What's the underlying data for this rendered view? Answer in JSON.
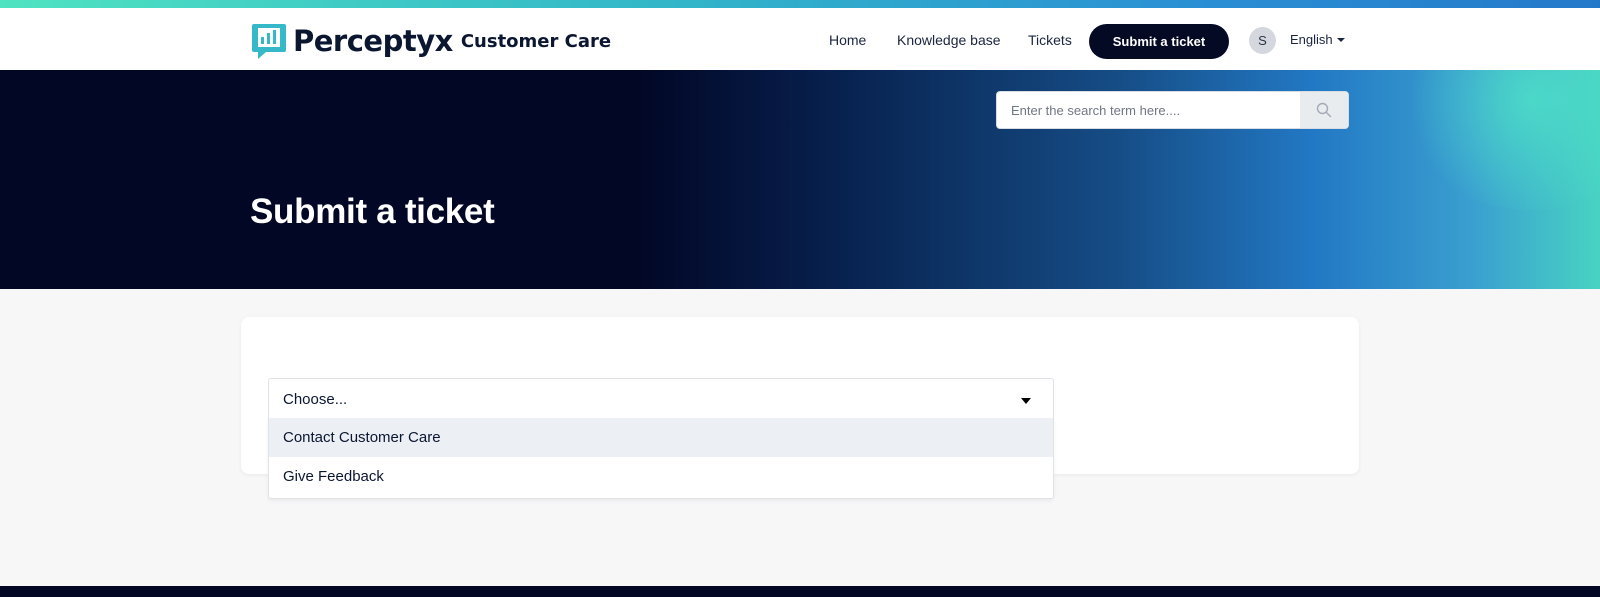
{
  "header": {
    "brand": "Perceptyx",
    "brand_sub": "Customer Care",
    "nav": {
      "home": "Home",
      "knowledge_base": "Knowledge base",
      "tickets": "Tickets",
      "submit": "Submit a ticket"
    },
    "avatar_initial": "S",
    "language": "English"
  },
  "search": {
    "placeholder": "Enter the search term here...."
  },
  "hero": {
    "title": "Submit a ticket"
  },
  "form": {
    "select_value": "Choose...",
    "options": [
      "Contact Customer Care",
      "Give Feedback"
    ]
  },
  "colors": {
    "brand_dark": "#050a24",
    "logo_accent": "#35b9c9"
  },
  "icons": {
    "logo": "chat-bar-chart-icon",
    "search": "search-icon",
    "dropdown": "caret-down-icon"
  }
}
